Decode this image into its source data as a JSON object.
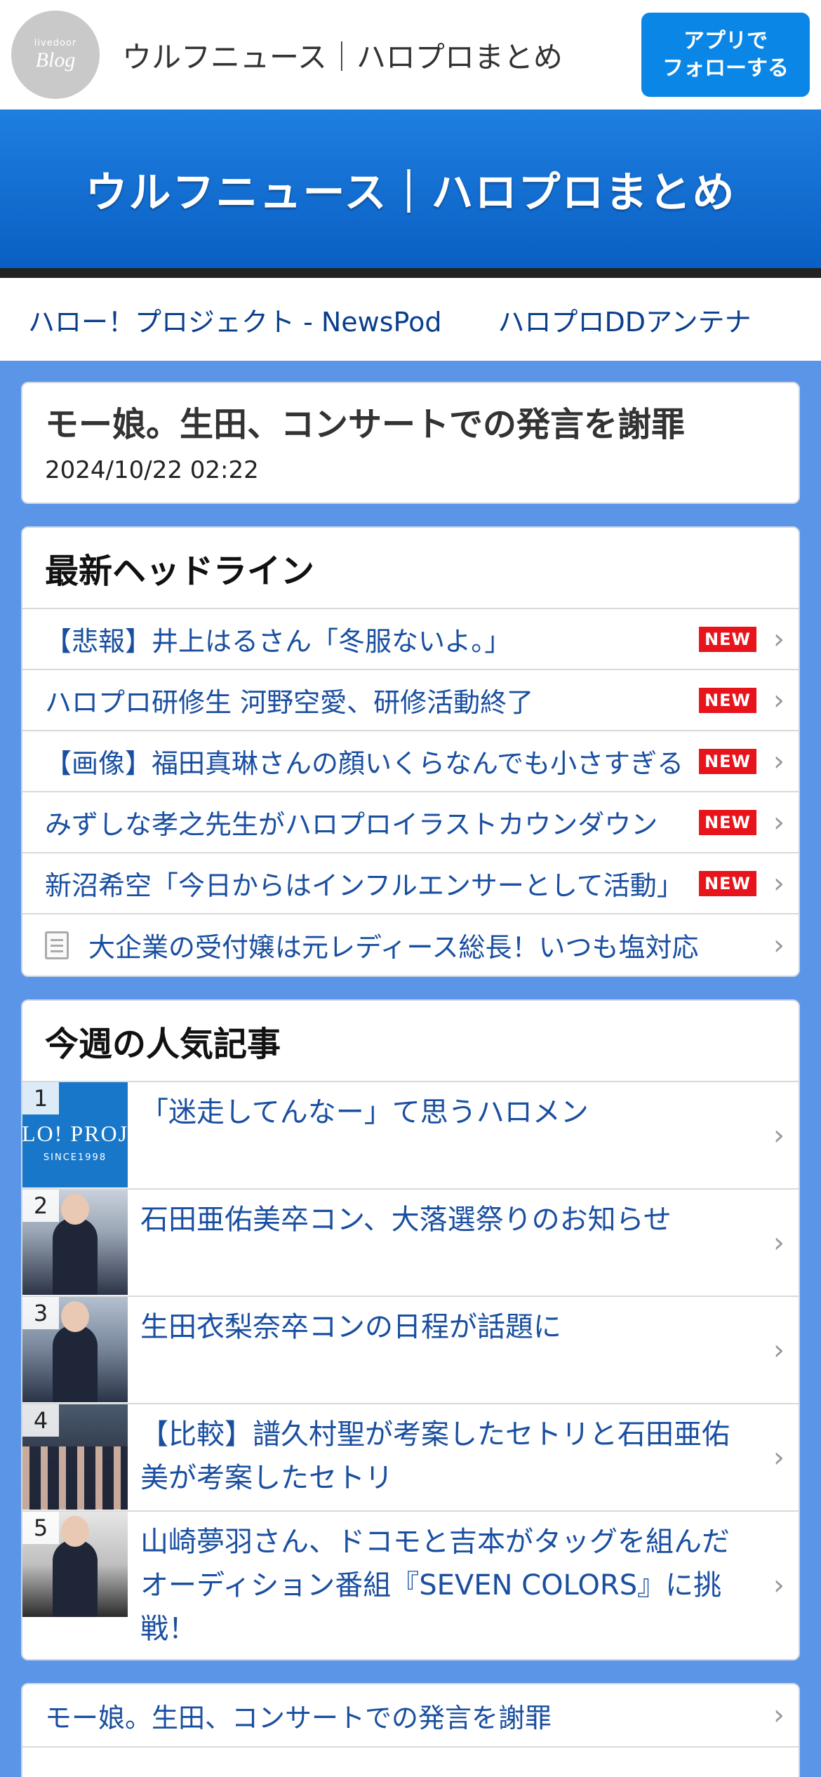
{
  "topbar": {
    "logo_small": "livedoor",
    "logo_big": "Blog",
    "site_name": "ウルフニュース｜ハロプロまとめ",
    "follow_line1": "アプリで",
    "follow_line2": "フォローする"
  },
  "hero": {
    "title": "ウルフニュース｜ハロプロまとめ"
  },
  "links": [
    {
      "label": "ハロー！プロジェクト - NewsPod"
    },
    {
      "label": "ハロプロDDアンテナ"
    }
  ],
  "article": {
    "title": "モー娘。生田、コンサートでの発言を謝罪",
    "date": "2024/10/22 02:22"
  },
  "headlines": {
    "heading": "最新ヘッドライン",
    "badge": "NEW",
    "items": [
      {
        "text": "【悲報】井上はるさん「冬服ないよ。」",
        "new": true
      },
      {
        "text": "ハロプロ研修生 河野空愛、研修活動終了",
        "new": true
      },
      {
        "text": "【画像】福田真琳さんの顔いくらなんでも小さすぎる",
        "new": true
      },
      {
        "text": "みずしな孝之先生がハロプロイラストカウンダウン",
        "new": true
      },
      {
        "text": "新沼希空「今日からはインフルエンサーとして活動」",
        "new": true
      },
      {
        "text": "大企業の受付嬢は元レディース総長！いつも塩対応",
        "new": false
      }
    ]
  },
  "popular": {
    "heading": "今週の人気記事",
    "thumb1_text": "LO! PROJ",
    "thumb1_sub": "SINCE1998",
    "items": [
      {
        "rank": "1",
        "text": "「迷走してんなー」て思うハロメン"
      },
      {
        "rank": "2",
        "text": "石田亜佑美卒コン、大落選祭りのお知らせ"
      },
      {
        "rank": "3",
        "text": "生田衣梨奈卒コンの日程が話題に"
      },
      {
        "rank": "4",
        "text": "【比較】譜久村聖が考案したセトリと石田亜佑美が考案したセトリ"
      },
      {
        "rank": "5",
        "text": "山崎夢羽さん、ドコモと吉本がタッグを組んだオーディション番組『SEVEN COLORS』に挑戦！"
      }
    ]
  },
  "bottom": {
    "items": [
      {
        "text": "モー娘。生田、コンサートでの発言を謝罪"
      }
    ]
  }
}
